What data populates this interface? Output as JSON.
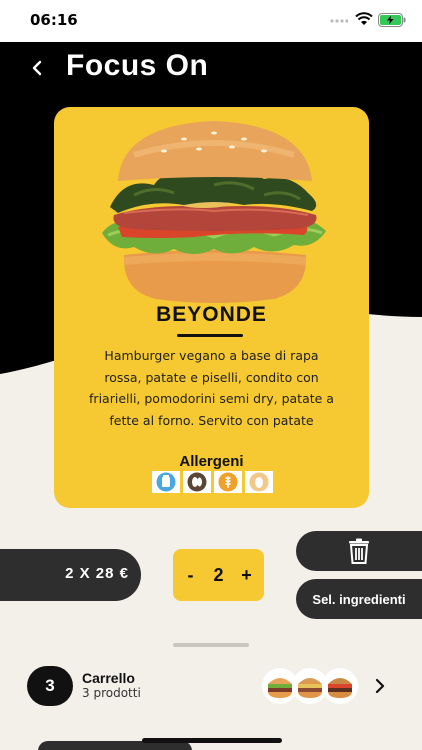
{
  "status_bar": {
    "time": "06:16"
  },
  "header": {
    "title": "Focus On"
  },
  "product": {
    "name": "BEYONDE",
    "description": "Hamburger vegano a base di rapa rossa, patate e piselli, condito con friarielli, pomodorini semi dry, patate a fette al forno. Servito con patate",
    "allergens_title": "Allergeni",
    "allergens": [
      "milk-icon",
      "soy-icon",
      "cereal-icon",
      "egg-icon"
    ]
  },
  "order": {
    "price_label": "2 X 28 €",
    "quantity": "2",
    "minus_label": "-",
    "plus_label": "+",
    "ingredients_label": "Sel. ingredienti"
  },
  "cart": {
    "count": "3",
    "title": "Carrello",
    "subtitle": "3 prodotti"
  },
  "colors": {
    "accent": "#f6c832",
    "dark": "#2e2e2e",
    "background": "#f3f0ea"
  }
}
